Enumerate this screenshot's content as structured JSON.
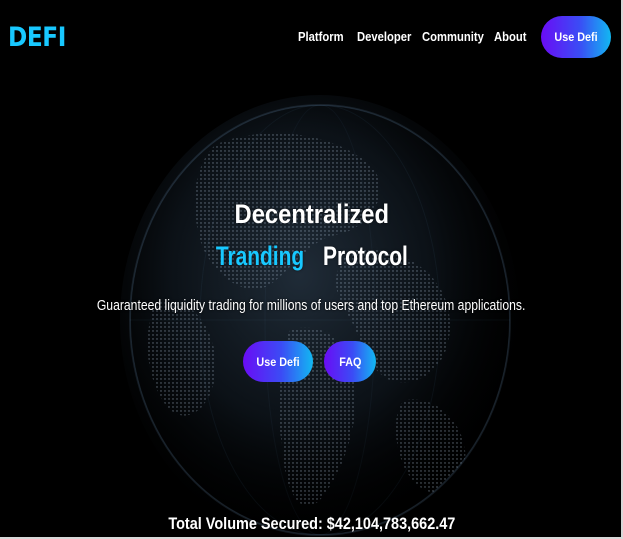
{
  "brand": {
    "logo": "DEFI"
  },
  "nav": {
    "items": [
      "Platform",
      "Developer",
      "Community",
      "About"
    ],
    "cta_label": "Use Defi"
  },
  "hero": {
    "title_line1": "Decentralized",
    "title_accent": "Tranding",
    "title_rest": "Protocol",
    "subtitle": "Guaranteed liquidity trading for millions of users and top Ethereum applications.",
    "primary_button": "Use Defi",
    "secondary_button": "FAQ"
  },
  "stats": {
    "volume_text": "Total Volume Secured: $42,104,783,662.47"
  },
  "colors": {
    "accent": "#18c8ff",
    "button_gradient_start": "#6a0cf5",
    "button_gradient_end": "#12b8f2",
    "background": "#000000"
  },
  "icons": {
    "background": "globe-illustration"
  }
}
